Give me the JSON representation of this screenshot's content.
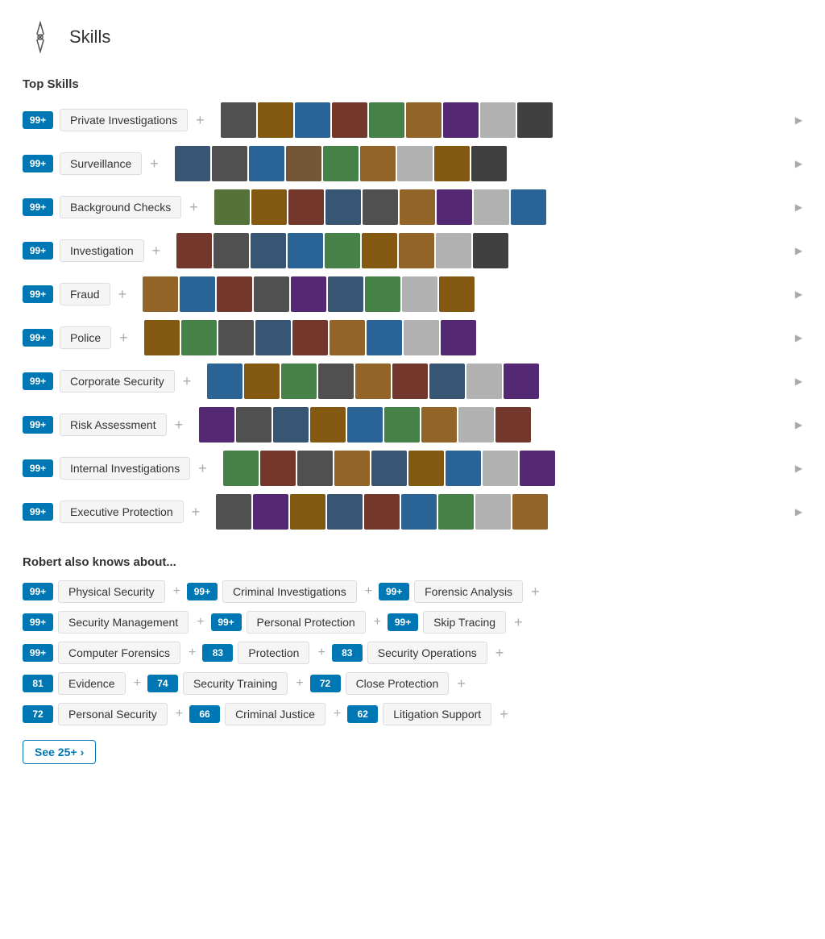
{
  "header": {
    "title": "Skills",
    "icon": "compass"
  },
  "topSkills": {
    "sectionLabel": "Top Skills",
    "skills": [
      {
        "badge": "99+",
        "label": "Private Investigations"
      },
      {
        "badge": "99+",
        "label": "Surveillance"
      },
      {
        "badge": "99+",
        "label": "Background Checks"
      },
      {
        "badge": "99+",
        "label": "Investigation"
      },
      {
        "badge": "99+",
        "label": "Fraud"
      },
      {
        "badge": "99+",
        "label": "Police"
      },
      {
        "badge": "99+",
        "label": "Corporate Security"
      },
      {
        "badge": "99+",
        "label": "Risk Assessment"
      },
      {
        "badge": "99+",
        "label": "Internal Investigations"
      },
      {
        "badge": "99+",
        "label": "Executive Protection"
      }
    ]
  },
  "alsoKnows": {
    "sectionLabel": "Robert also knows about...",
    "rows": [
      [
        {
          "badge": "99+",
          "label": "Physical Security"
        },
        {
          "badge": "99+",
          "label": "Criminal Investigations"
        },
        {
          "badge": "99+",
          "label": "Forensic Analysis"
        }
      ],
      [
        {
          "badge": "99+",
          "label": "Security Management"
        },
        {
          "badge": "99+",
          "label": "Personal Protection"
        },
        {
          "badge": "99+",
          "label": "Skip Tracing"
        }
      ],
      [
        {
          "badge": "99+",
          "label": "Computer Forensics"
        },
        {
          "badge": "83",
          "label": "Protection"
        },
        {
          "badge": "83",
          "label": "Security Operations"
        }
      ],
      [
        {
          "badge": "81",
          "label": "Evidence"
        },
        {
          "badge": "74",
          "label": "Security Training"
        },
        {
          "badge": "72",
          "label": "Close Protection"
        }
      ],
      [
        {
          "badge": "72",
          "label": "Personal Security"
        },
        {
          "badge": "66",
          "label": "Criminal Justice"
        },
        {
          "badge": "62",
          "label": "Litigation Support"
        }
      ]
    ],
    "seeMore": "See 25+"
  },
  "avatarColors": [
    [
      "#555",
      "#8B5e14",
      "#2d6a9f",
      "#7a3b2e",
      "#4a8a4b",
      "#9a6a2b",
      "#5a2b7a",
      "#bbb",
      "#444"
    ],
    [
      "#3b5a7a",
      "#555",
      "#2d6a9f",
      "#7a5a3b",
      "#4a8a4b",
      "#9a6a2b",
      "#bbb",
      "#8B5e14",
      "#444"
    ],
    [
      "#5a7a3b",
      "#8B5e14",
      "#7a3b2e",
      "#3b5a7a",
      "#555",
      "#9a6a2b",
      "#5a2b7a",
      "#bbb",
      "#2d6a9f"
    ],
    [
      "#7a3b2e",
      "#555",
      "#3b5a7a",
      "#2d6a9f",
      "#4a8a4b",
      "#8B5e14",
      "#9a6a2b",
      "#bbb",
      "#444"
    ],
    [
      "#9a6a2b",
      "#2d6a9f",
      "#7a3b2e",
      "#555",
      "#5a2b7a",
      "#3b5a7a",
      "#4a8a4b",
      "#bbb",
      "#8B5e14"
    ],
    [
      "#8B5e14",
      "#4a8a4b",
      "#555",
      "#3b5a7a",
      "#7a3b2e",
      "#9a6a2b",
      "#2d6a9f",
      "#bbb",
      "#5a2b7a"
    ],
    [
      "#2d6a9f",
      "#8B5e14",
      "#4a8a4b",
      "#555",
      "#9a6a2b",
      "#7a3b2e",
      "#3b5a7a",
      "#bbb",
      "#5a2b7a"
    ],
    [
      "#5a2b7a",
      "#555",
      "#3b5a7a",
      "#8B5e14",
      "#2d6a9f",
      "#4a8a4b",
      "#9a6a2b",
      "#bbb",
      "#7a3b2e"
    ],
    [
      "#4a8a4b",
      "#7a3b2e",
      "#555",
      "#9a6a2b",
      "#3b5a7a",
      "#8B5e14",
      "#2d6a9f",
      "#bbb",
      "#5a2b7a"
    ],
    [
      "#555",
      "#5a2b7a",
      "#8B5e14",
      "#3b5a7a",
      "#7a3b2e",
      "#2d6a9f",
      "#4a8a4b",
      "#bbb",
      "#9a6a2b"
    ]
  ]
}
